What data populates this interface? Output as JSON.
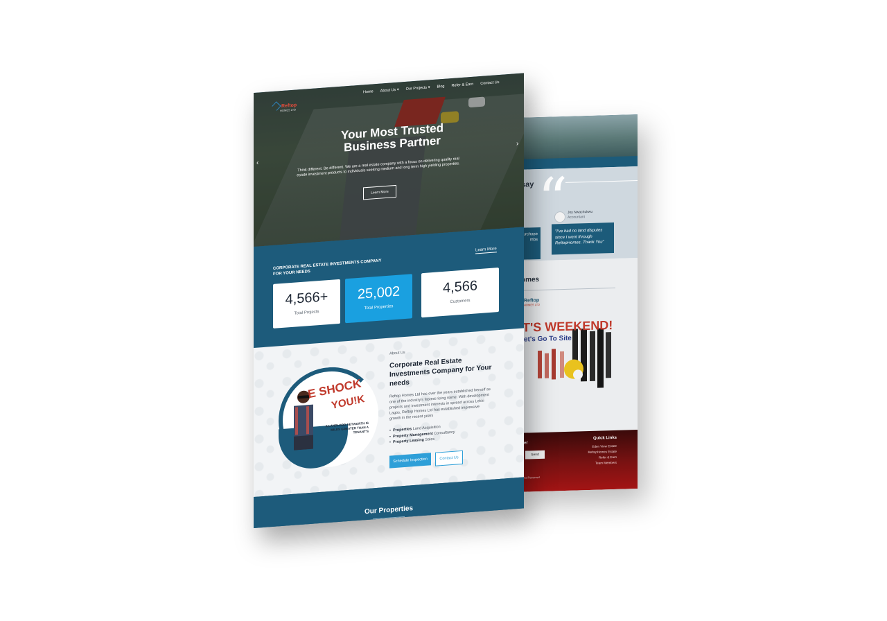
{
  "front": {
    "nav": {
      "logo": "Reftop",
      "logo_sub": "HOMES LTD",
      "items": [
        "Home",
        "About Us",
        "Our Projects",
        "Blog",
        "Refer & Earn",
        "Contact Us"
      ]
    },
    "hero": {
      "title_line1": "Your Most Trusted",
      "title_line2": "Business Partner",
      "subtitle": "Think different. Be different. We are a real estate company with a focus on delivering quality real estate investment products to individuals seeking medium and long term high yielding properties.",
      "button": "Learn More",
      "prev_icon": "chevron-left-icon",
      "next_icon": "chevron-right-icon"
    },
    "stats": {
      "heading_line1": "CORPORATE REAL ESTATE INVESTMENTS COMPANY",
      "heading_line2": "FOR YOUR NEEDS",
      "learn_more": "Learn More",
      "items": [
        {
          "value": "4,566+",
          "label": "Total Projects"
        },
        {
          "value": "25,002",
          "label": "Total Properties"
        },
        {
          "value": "4,566",
          "label": "Customers"
        }
      ]
    },
    "about": {
      "label": "About Us",
      "title": "Corporate Real Estate Investments Company for Your needs",
      "description": "Reftop Homes Ltd has over the years established herself as one of the industry's fastest rising name. With development projects and investment interests in spread across Lekki Lagos, Reftop Homes Ltd has established impressive growth in the recent years",
      "list": [
        {
          "bold": "Properties",
          "rest": "Land Acquisition"
        },
        {
          "bold": "Property Management",
          "rest": "Consultancy"
        },
        {
          "bold": "Property Leasing",
          "rest": "Sales"
        }
      ],
      "shock_line1": "E SHOCK",
      "shock_line2": "YOU!K",
      "landlord_text": "A LANDLORD NETWORTH IS MILES GREATER THAN A TENANT'S",
      "schedule_button": "Schedule Inspection",
      "contact_button": "Contact Us"
    },
    "properties": {
      "title": "Our Properties"
    }
  },
  "back": {
    "testimonials": {
      "title_fragment": "say",
      "name": "Joy Nwachukwu",
      "role": "Accountant",
      "card_left": "urchase mbs",
      "card_right": "\"I've had no land disputes since I went through ReftopHomes. Thank You\""
    },
    "homes": {
      "title_fragment": "omes",
      "logo": "Reftop",
      "logo_sub": "HOMES LTD",
      "weekend": "T'S WEEKEND!",
      "go_to_site": "et's Go To Site"
    },
    "footer": {
      "newsletter_fragment": "tter",
      "send_button": "Send",
      "quick_links_title": "Quick Links",
      "links": [
        "Eden View Estate",
        "ReftopHomes Estate",
        "Refer & Earn",
        "Team Members"
      ],
      "copyright": "ights Reserved"
    }
  },
  "colors": {
    "brand_blue": "#1d5b7b",
    "accent_blue": "#1aa0e0",
    "brand_red": "#c0392b"
  }
}
